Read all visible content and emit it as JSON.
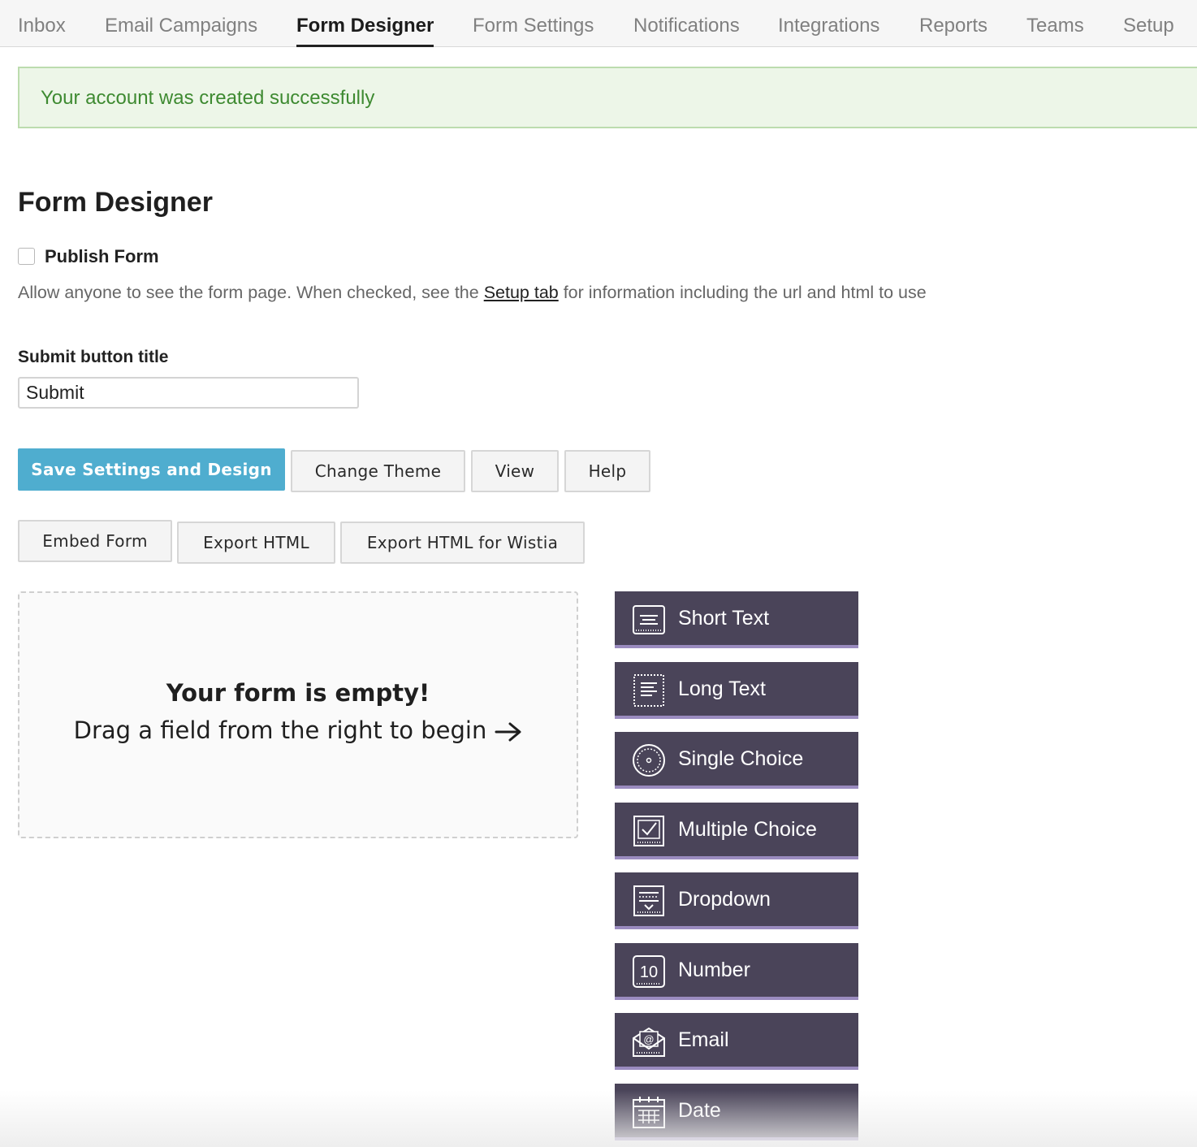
{
  "nav": {
    "tabs": [
      {
        "label": "Inbox",
        "active": false
      },
      {
        "label": "Email Campaigns",
        "active": false
      },
      {
        "label": "Form Designer",
        "active": true
      },
      {
        "label": "Form Settings",
        "active": false
      },
      {
        "label": "Notifications",
        "active": false
      },
      {
        "label": "Integrations",
        "active": false
      },
      {
        "label": "Reports",
        "active": false
      },
      {
        "label": "Teams",
        "active": false
      },
      {
        "label": "Setup",
        "active": false
      }
    ]
  },
  "banner": {
    "message": "Your account was created successfully"
  },
  "page": {
    "title": "Form Designer"
  },
  "publish": {
    "label": "Publish Form",
    "checked": false,
    "help_before": "Allow anyone to see the form page. When checked, see the ",
    "help_link": "Setup tab",
    "help_after": " for information including the url and html to use"
  },
  "submit_field": {
    "label": "Submit button title",
    "value": "Submit"
  },
  "actions": {
    "save": "Save Settings and Design",
    "change_theme": "Change Theme",
    "view": "View",
    "help": "Help",
    "embed": "Embed Form",
    "export_html": "Export HTML",
    "export_wistia": "Export HTML for Wistia"
  },
  "dropzone": {
    "title": "Your form is empty!",
    "subtitle": "Drag a field from the right to begin"
  },
  "palette": [
    {
      "label": "Short Text",
      "icon": "short-text-icon"
    },
    {
      "label": "Long Text",
      "icon": "long-text-icon"
    },
    {
      "label": "Single Choice",
      "icon": "radio-icon"
    },
    {
      "label": "Multiple Choice",
      "icon": "checkbox-icon"
    },
    {
      "label": "Dropdown",
      "icon": "dropdown-icon"
    },
    {
      "label": "Number",
      "icon": "number-icon"
    },
    {
      "label": "Email",
      "icon": "email-icon"
    },
    {
      "label": "Date",
      "icon": "calendar-icon"
    }
  ],
  "colors": {
    "primary_button": "#4fadcf",
    "palette_bg": "#4a4459",
    "palette_accent": "#9a8bbf",
    "banner_bg": "#edf6e8",
    "banner_text": "#3e8a31"
  }
}
